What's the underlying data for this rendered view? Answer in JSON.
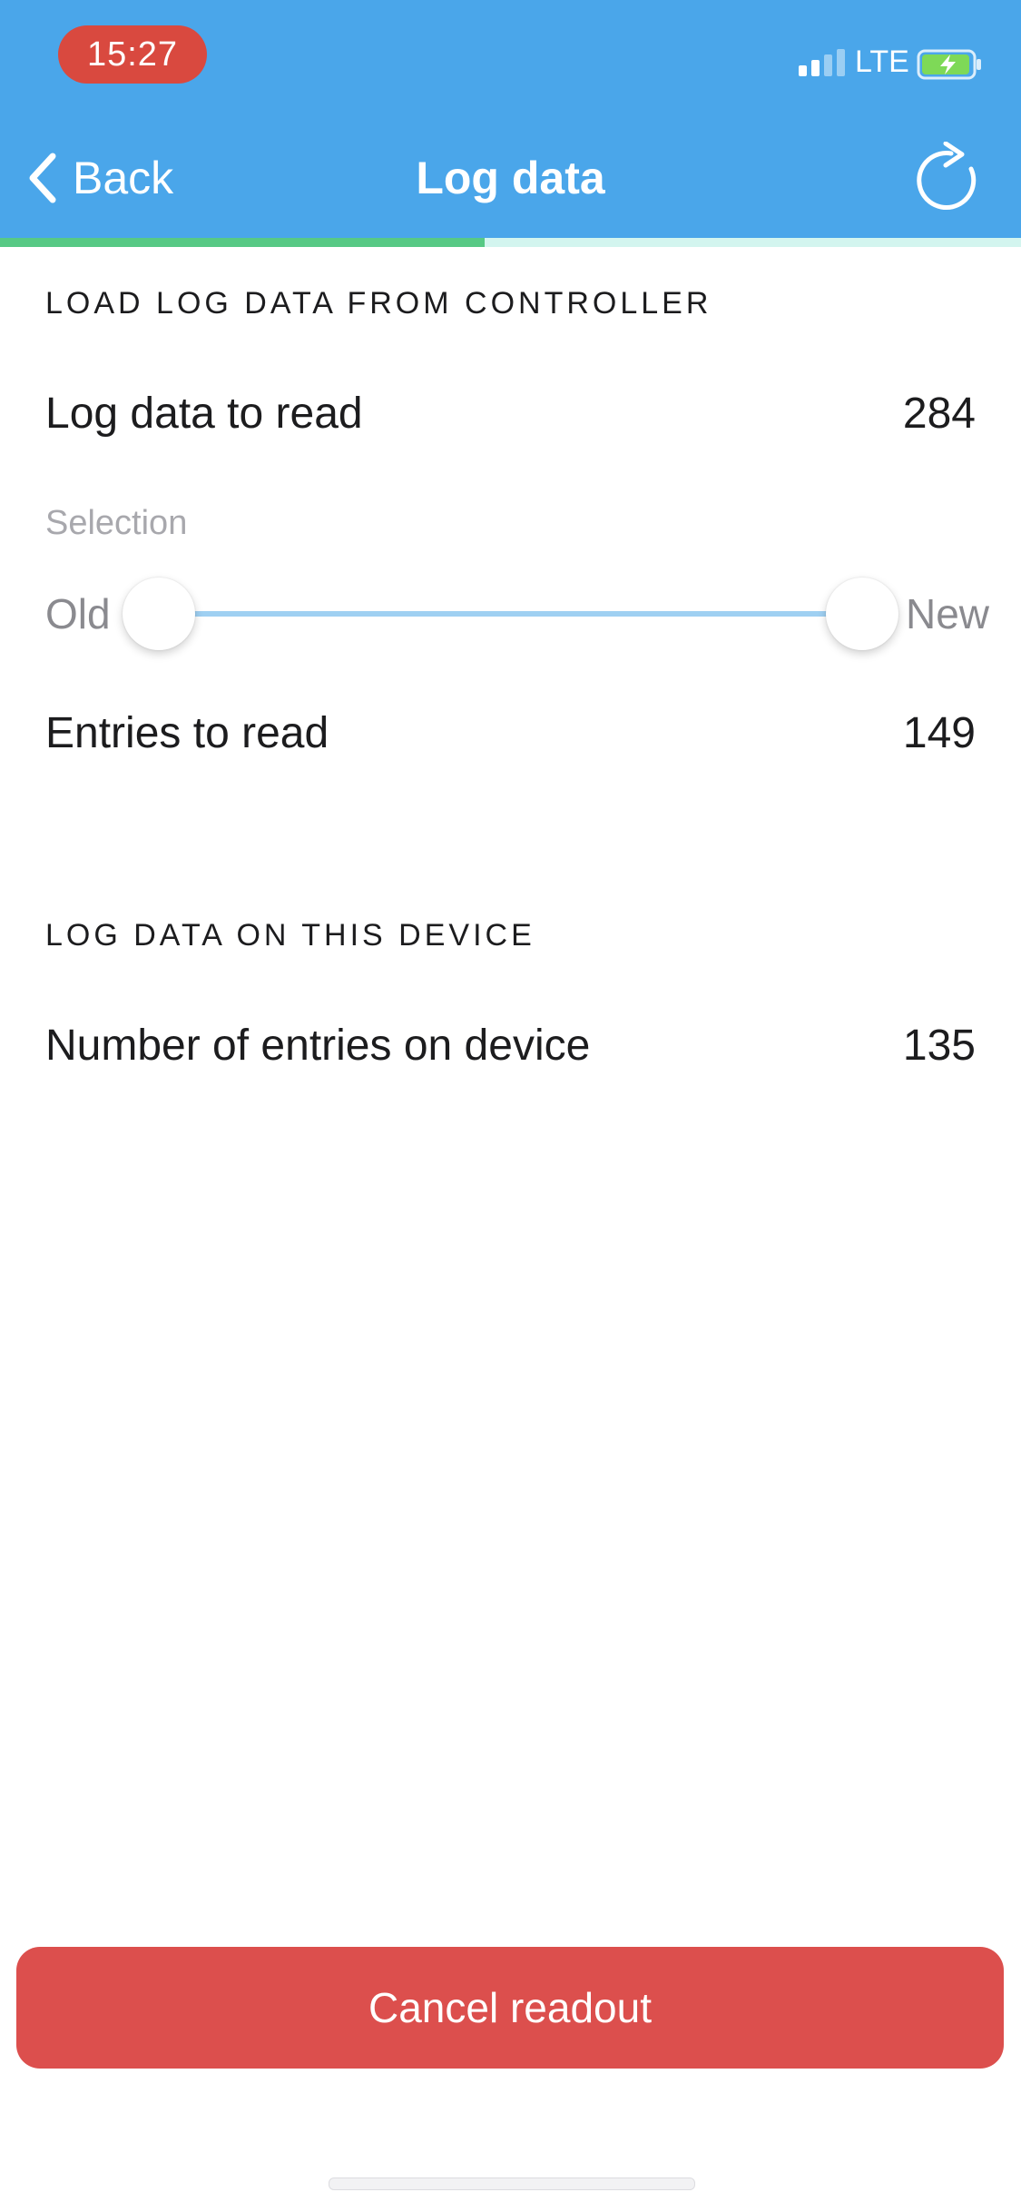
{
  "status_bar": {
    "time": "15:27",
    "network": "LTE",
    "signal_bars_active": 2,
    "signal_bars_total": 4,
    "battery_state": "charging"
  },
  "nav": {
    "back_label": "Back",
    "title": "Log data",
    "back_icon": "chevron-left-icon",
    "refresh_icon": "refresh-icon",
    "progress_percent": 47.5
  },
  "load_section": {
    "header": "LOAD LOG DATA FROM CONTROLLER",
    "log_to_read": {
      "label": "Log data to read",
      "value": "284"
    },
    "selection_label": "Selection",
    "slider": {
      "min_label": "Old",
      "max_label": "New",
      "range_start_percent": 0,
      "range_end_percent": 100
    },
    "entries_to_read": {
      "label": "Entries to read",
      "value": "149"
    }
  },
  "device_section": {
    "header": "LOG DATA ON THIS DEVICE",
    "entries_on_device": {
      "label": "Number of entries on device",
      "value": "135"
    }
  },
  "actions": {
    "cancel_label": "Cancel readout"
  },
  "colors": {
    "header_bg": "#4aa6ea",
    "time_pill": "#d9493f",
    "progress_fill": "#57c985",
    "progress_track": "#d3f5ef",
    "slider_range": "#9fd0f2",
    "cancel_button": "#dc4f4d",
    "battery_fill": "#7ed957"
  }
}
